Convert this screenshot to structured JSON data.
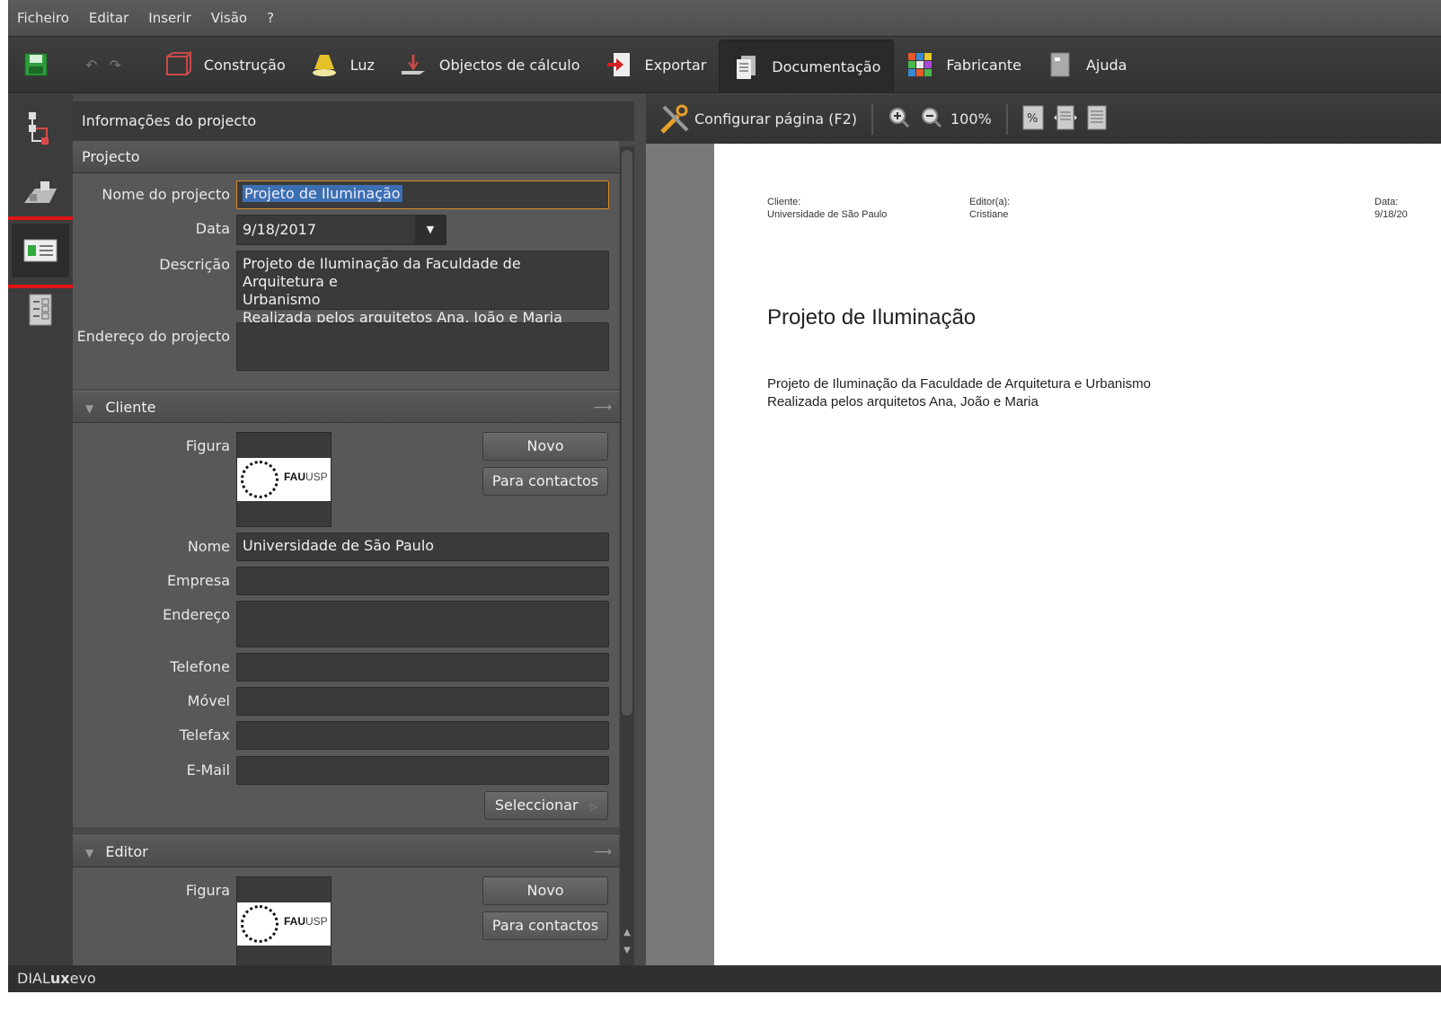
{
  "menu": [
    "Ficheiro",
    "Editar",
    "Inserir",
    "Visão",
    "?"
  ],
  "toolbar": {
    "undo_redo": "↶ ↷",
    "tabs": [
      "Construção",
      "Luz",
      "Objectos de cálculo",
      "Exportar",
      "Documentação",
      "Fabricante",
      "Ajuda"
    ],
    "active_tab": "Documentação"
  },
  "panel": {
    "title": "Informações do projecto",
    "project": {
      "section_title": "Projecto",
      "name_label": "Nome do projecto",
      "name_value": "Projeto de Iluminação",
      "date_label": "Data",
      "date_value": "9/18/2017",
      "desc_label": "Descrição",
      "desc_line1": "Projeto de Iluminação da Faculdade de Arquitetura e",
      "desc_line2": "Urbanismo",
      "desc_line3": "Realizada pelos arquitetos Ana, João e Maria",
      "address_label": "Endereço do projecto",
      "address_value": ""
    },
    "client": {
      "section_title": "Cliente",
      "figure_label": "Figura",
      "logo_text_bold": "FAU",
      "logo_text_rest": "USP",
      "new_button": "Novo",
      "contacts_button": "Para contactos",
      "name_label": "Nome",
      "name_value": "Universidade de São Paulo",
      "company_label": "Empresa",
      "company_value": "",
      "address_label": "Endereço",
      "address_value": "",
      "phone_label": "Telefone",
      "phone_value": "",
      "mobile_label": "Móvel",
      "mobile_value": "",
      "fax_label": "Telefax",
      "fax_value": "",
      "email_label": "E-Mail",
      "email_value": "",
      "select_button": "Seleccionar"
    },
    "editor": {
      "section_title": "Editor",
      "figure_label": "Figura",
      "logo_text_bold": "FAU",
      "logo_text_rest": "USP",
      "new_button": "Novo",
      "contacts_button": "Para contactos"
    }
  },
  "doc_toolbar": {
    "page_setup": "Configurar página (F2)",
    "zoom": "100%"
  },
  "document": {
    "client_label": "Cliente:",
    "client_value": "Universidade de São Paulo",
    "editor_label": "Editor(a):",
    "editor_value": "Cristiane",
    "date_label": "Data:",
    "date_value": "9/18/20",
    "title": "Projeto de Iluminação",
    "desc_line1": "Projeto de Iluminação da Faculdade de Arquitetura e Urbanismo",
    "desc_line2": "Realizada pelos arquitetos Ana, João e Maria"
  },
  "status": {
    "brand_a": "DIAL",
    "brand_b": "ux",
    "brand_c": "evo"
  },
  "colors": {
    "highlight_box": "#e01414",
    "focus_border": "#d98a2a",
    "selection": "#3b6fb0"
  }
}
